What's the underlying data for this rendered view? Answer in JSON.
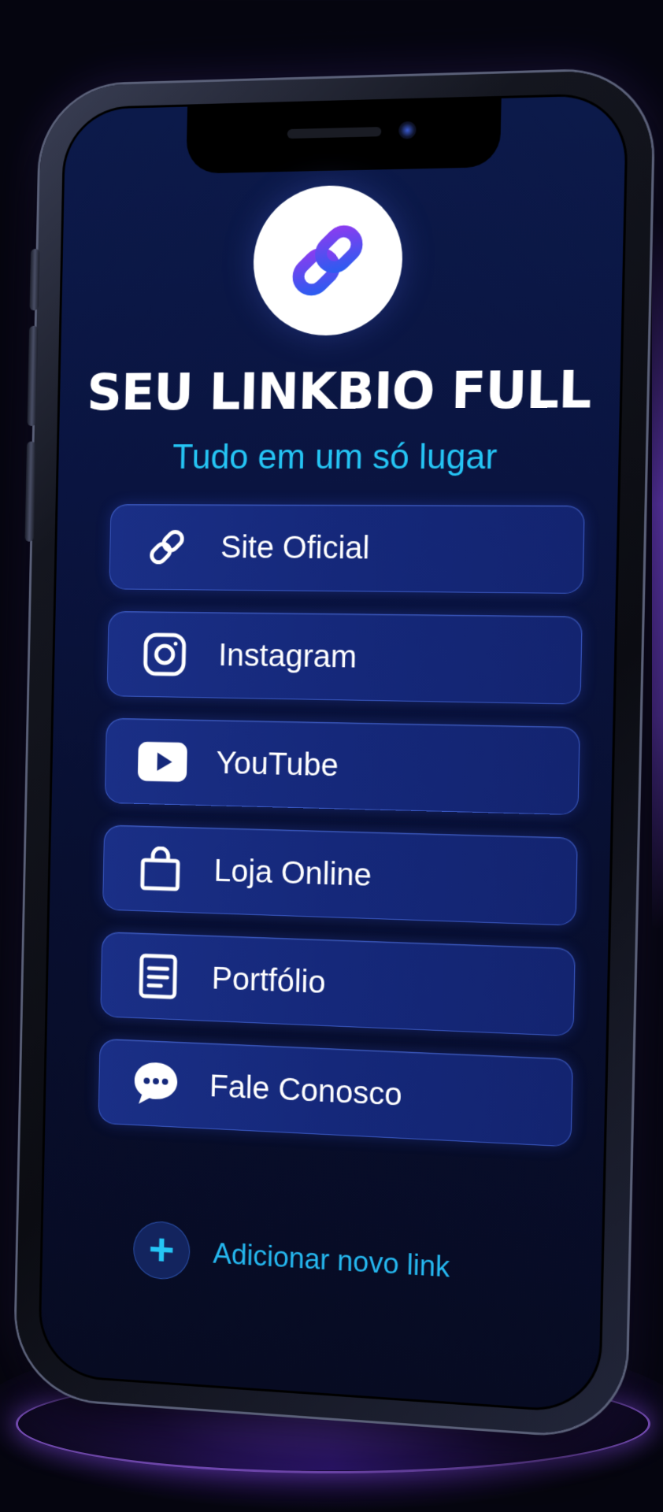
{
  "header": {
    "title": "SEU LINKBIO FULL",
    "subtitle": "Tudo em um só lugar"
  },
  "links": [
    {
      "label": "Site Oficial",
      "icon": "link-icon"
    },
    {
      "label": "Instagram",
      "icon": "instagram-icon"
    },
    {
      "label": "YouTube",
      "icon": "youtube-icon"
    },
    {
      "label": "Loja Online",
      "icon": "shopping-bag-icon"
    },
    {
      "label": "Portfólio",
      "icon": "document-icon"
    },
    {
      "label": "Fale Conosco",
      "icon": "chat-bubble-icon"
    }
  ],
  "add_link": {
    "label": "Adicionar novo link",
    "icon": "plus-icon"
  },
  "logo": {
    "icon": "chain-link-logo-icon"
  },
  "colors": {
    "accent": "#25c5f5",
    "button_bg": "#172b80",
    "screen_bg": "#0a1440",
    "logo_blue": "#2b5cf0",
    "logo_purple": "#8a3cf0"
  }
}
